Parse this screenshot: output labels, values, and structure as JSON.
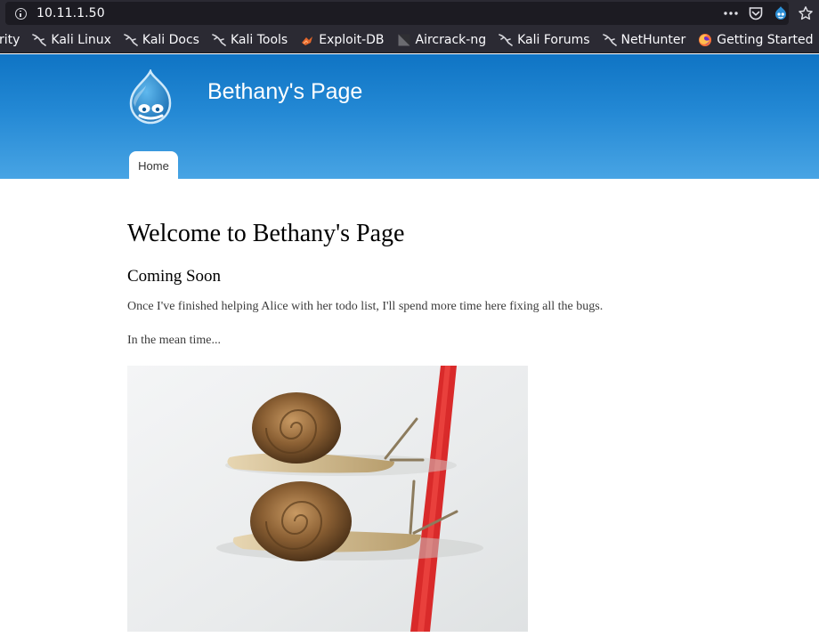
{
  "browser": {
    "url": "10.11.1.50",
    "icons": [
      "info-icon",
      "more-icon",
      "pocket-icon",
      "drupal-icon",
      "star-icon"
    ]
  },
  "bookmarks": [
    {
      "label": "rity",
      "icon": ""
    },
    {
      "label": "Kali Linux",
      "icon": "kali-dragon-icon"
    },
    {
      "label": "Kali Docs",
      "icon": "kali-dragon-icon"
    },
    {
      "label": "Kali Tools",
      "icon": "kali-dragon-icon"
    },
    {
      "label": "Exploit-DB",
      "icon": "exploit-db-icon"
    },
    {
      "label": "Aircrack-ng",
      "icon": "aircrack-icon"
    },
    {
      "label": "Kali Forums",
      "icon": "kali-dragon-icon"
    },
    {
      "label": "NetHunter",
      "icon": "kali-dragon-icon"
    },
    {
      "label": "Getting Started",
      "icon": "firefox-icon"
    }
  ],
  "site": {
    "name": "Bethany's Page",
    "nav": {
      "home": "Home"
    },
    "colors": {
      "header_top": "#0f74c4",
      "header_bottom": "#48a4e4"
    }
  },
  "content": {
    "title": "Welcome to Bethany's Page",
    "subtitle": "Coming Soon",
    "paragraph1": "Once I've finished helping Alice with her todo list, I'll spend more time here fixing all the bugs.",
    "paragraph2": "In the mean time..."
  }
}
